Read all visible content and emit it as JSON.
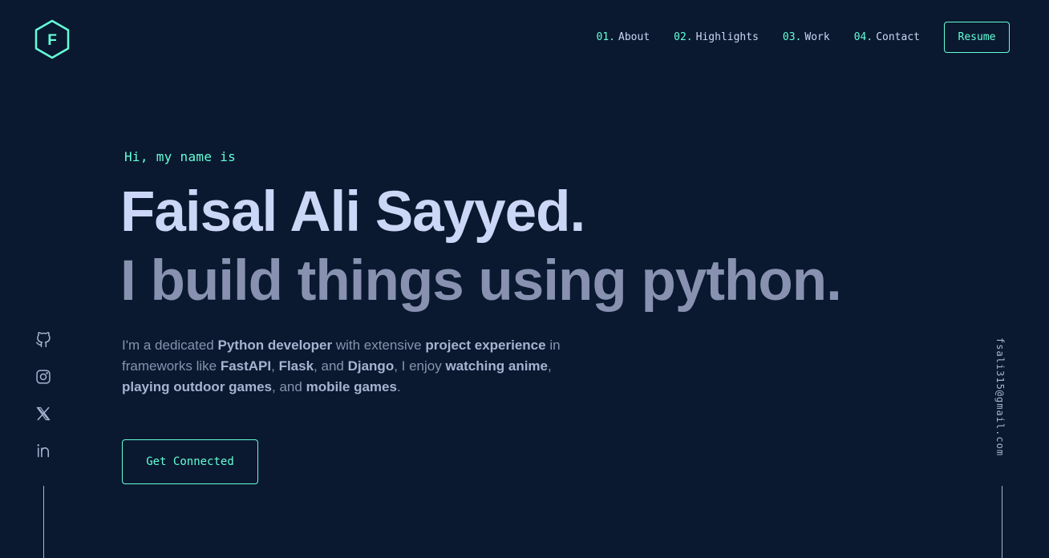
{
  "header": {
    "logo_letter": "F",
    "nav": [
      {
        "num": "01.",
        "label": "About"
      },
      {
        "num": "02.",
        "label": "Highlights"
      },
      {
        "num": "03.",
        "label": "Work"
      },
      {
        "num": "04.",
        "label": "Contact"
      }
    ],
    "resume_label": "Resume"
  },
  "hero": {
    "greeting": "Hi, my name is",
    "name": "Faisal Ali Sayyed.",
    "tagline": "I build things using python.",
    "bio": [
      {
        "t": "I'm a dedicated ",
        "b": false
      },
      {
        "t": "Python developer",
        "b": true
      },
      {
        "t": " with extensive ",
        "b": false
      },
      {
        "t": "project experience",
        "b": true
      },
      {
        "t": " in frameworks like ",
        "b": false
      },
      {
        "t": "FastAPI",
        "b": true
      },
      {
        "t": ", ",
        "b": false
      },
      {
        "t": "Flask",
        "b": true
      },
      {
        "t": ", and ",
        "b": false
      },
      {
        "t": "Django",
        "b": true
      },
      {
        "t": ", I enjoy ",
        "b": false
      },
      {
        "t": "watching anime",
        "b": true
      },
      {
        "t": ", ",
        "b": false
      },
      {
        "t": "playing outdoor games",
        "b": true
      },
      {
        "t": ", and ",
        "b": false
      },
      {
        "t": "mobile games",
        "b": true
      },
      {
        "t": ".",
        "b": false
      }
    ],
    "cta_label": "Get Connected"
  },
  "socials": [
    {
      "name": "github-icon"
    },
    {
      "name": "instagram-icon"
    },
    {
      "name": "x-twitter-icon"
    },
    {
      "name": "linkedin-icon"
    }
  ],
  "email": "fsali315@gmail.com",
  "colors": {
    "background": "#0a192f",
    "accent": "#64ffda",
    "heading": "#ccd6f6",
    "text": "#8892b0"
  }
}
